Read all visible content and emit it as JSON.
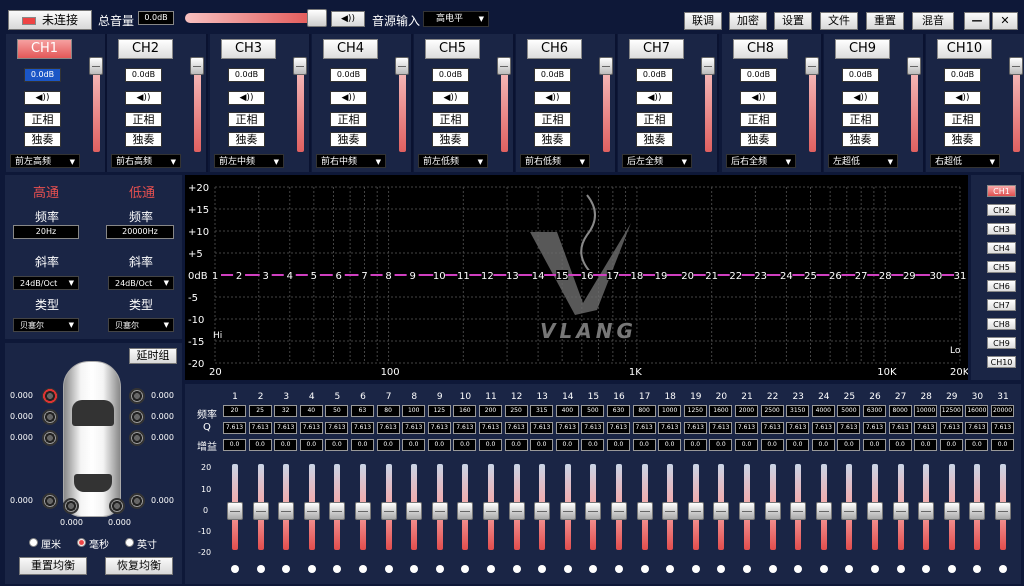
{
  "toolbar": {
    "connect_label": "未连接",
    "master_label": "总音量",
    "master_value": "0.0dB",
    "source_label": "音源输入",
    "source_value": "高电平",
    "buttons": [
      "联调",
      "加密",
      "设置",
      "文件",
      "重置",
      "混音"
    ],
    "minimize": "—",
    "close": "✕"
  },
  "channels": [
    {
      "name": "CH1",
      "vol": "0.0dB",
      "mute": "◀))",
      "phase": "正相",
      "solo": "独奏",
      "assign": "前左高频"
    },
    {
      "name": "CH2",
      "vol": "0.0dB",
      "mute": "◀))",
      "phase": "正相",
      "solo": "独奏",
      "assign": "前右高频"
    },
    {
      "name": "CH3",
      "vol": "0.0dB",
      "mute": "◀))",
      "phase": "正相",
      "solo": "独奏",
      "assign": "前左中频"
    },
    {
      "name": "CH4",
      "vol": "0.0dB",
      "mute": "◀))",
      "phase": "正相",
      "solo": "独奏",
      "assign": "前右中频"
    },
    {
      "name": "CH5",
      "vol": "0.0dB",
      "mute": "◀))",
      "phase": "正相",
      "solo": "独奏",
      "assign": "前左低频"
    },
    {
      "name": "CH6",
      "vol": "0.0dB",
      "mute": "◀))",
      "phase": "正相",
      "solo": "独奏",
      "assign": "前右低频"
    },
    {
      "name": "CH7",
      "vol": "0.0dB",
      "mute": "◀))",
      "phase": "正相",
      "solo": "独奏",
      "assign": "后左全频"
    },
    {
      "name": "CH8",
      "vol": "0.0dB",
      "mute": "◀))",
      "phase": "正相",
      "solo": "独奏",
      "assign": "后右全频"
    },
    {
      "name": "CH9",
      "vol": "0.0dB",
      "mute": "◀))",
      "phase": "正相",
      "solo": "独奏",
      "assign": "左超低"
    },
    {
      "name": "CH10",
      "vol": "0.0dB",
      "mute": "◀))",
      "phase": "正相",
      "solo": "独奏",
      "assign": "右超低"
    }
  ],
  "crossover": {
    "hp_title": "高通",
    "lp_title": "低通",
    "freq_label": "频率",
    "hp_freq": "20Hz",
    "lp_freq": "20000Hz",
    "slope_label": "斜率",
    "hp_slope": "24dB/Oct",
    "lp_slope": "24dB/Oct",
    "type_label": "类型",
    "hp_type": "贝塞尔",
    "lp_type": "贝塞尔"
  },
  "graph": {
    "y_ticks": [
      "+20",
      "+15",
      "+10",
      "+5",
      "0dB",
      "-5",
      "-10",
      "-15",
      "-20"
    ],
    "x_ticks": [
      "20",
      "100",
      "1K",
      "10K",
      "20K"
    ],
    "band_markers": [
      "1",
      "2",
      "3",
      "4",
      "5",
      "6",
      "7",
      "8",
      "9",
      "10",
      "11",
      "12",
      "13",
      "14",
      "15",
      "16",
      "17",
      "18",
      "19",
      "20",
      "21",
      "22",
      "23",
      "24",
      "25",
      "26",
      "27",
      "28",
      "29",
      "30",
      "31"
    ],
    "hi_label": "Hi",
    "lo_label": "Lo",
    "logo_text": "VLANG",
    "curve_color": "#d040c0"
  },
  "channel_list": [
    "CH1",
    "CH2",
    "CH3",
    "CH4",
    "CH5",
    "CH6",
    "CH7",
    "CH8",
    "CH9",
    "CH10"
  ],
  "eq": {
    "freq_label": "频率",
    "q_label": "Q",
    "gain_label": "增益",
    "scale": [
      "20",
      "10",
      "0",
      "-10",
      "-20"
    ],
    "bands": [
      {
        "n": "1",
        "f": "20",
        "q": "7.613",
        "g": "0.0"
      },
      {
        "n": "2",
        "f": "25",
        "q": "7.613",
        "g": "0.0"
      },
      {
        "n": "3",
        "f": "32",
        "q": "7.613",
        "g": "0.0"
      },
      {
        "n": "4",
        "f": "40",
        "q": "7.613",
        "g": "0.0"
      },
      {
        "n": "5",
        "f": "50",
        "q": "7.613",
        "g": "0.0"
      },
      {
        "n": "6",
        "f": "63",
        "q": "7.613",
        "g": "0.0"
      },
      {
        "n": "7",
        "f": "80",
        "q": "7.613",
        "g": "0.0"
      },
      {
        "n": "8",
        "f": "100",
        "q": "7.613",
        "g": "0.0"
      },
      {
        "n": "9",
        "f": "125",
        "q": "7.613",
        "g": "0.0"
      },
      {
        "n": "10",
        "f": "160",
        "q": "7.613",
        "g": "0.0"
      },
      {
        "n": "11",
        "f": "200",
        "q": "7.613",
        "g": "0.0"
      },
      {
        "n": "12",
        "f": "250",
        "q": "7.613",
        "g": "0.0"
      },
      {
        "n": "13",
        "f": "315",
        "q": "7.613",
        "g": "0.0"
      },
      {
        "n": "14",
        "f": "400",
        "q": "7.613",
        "g": "0.0"
      },
      {
        "n": "15",
        "f": "500",
        "q": "7.613",
        "g": "0.0"
      },
      {
        "n": "16",
        "f": "630",
        "q": "7.613",
        "g": "0.0"
      },
      {
        "n": "17",
        "f": "800",
        "q": "7.613",
        "g": "0.0"
      },
      {
        "n": "18",
        "f": "1000",
        "q": "7.613",
        "g": "0.0"
      },
      {
        "n": "19",
        "f": "1250",
        "q": "7.613",
        "g": "0.0"
      },
      {
        "n": "20",
        "f": "1600",
        "q": "7.613",
        "g": "0.0"
      },
      {
        "n": "21",
        "f": "2000",
        "q": "7.613",
        "g": "0.0"
      },
      {
        "n": "22",
        "f": "2500",
        "q": "7.613",
        "g": "0.0"
      },
      {
        "n": "23",
        "f": "3150",
        "q": "7.613",
        "g": "0.0"
      },
      {
        "n": "24",
        "f": "4000",
        "q": "7.613",
        "g": "0.0"
      },
      {
        "n": "25",
        "f": "5000",
        "q": "7.613",
        "g": "0.0"
      },
      {
        "n": "26",
        "f": "6300",
        "q": "7.613",
        "g": "0.0"
      },
      {
        "n": "27",
        "f": "8000",
        "q": "7.613",
        "g": "0.0"
      },
      {
        "n": "28",
        "f": "10000",
        "q": "7.613",
        "g": "0.0"
      },
      {
        "n": "29",
        "f": "12500",
        "q": "7.613",
        "g": "0.0"
      },
      {
        "n": "30",
        "f": "16000",
        "q": "7.613",
        "g": "0.0"
      },
      {
        "n": "31",
        "f": "20000",
        "q": "7.613",
        "g": "0.0"
      }
    ]
  },
  "delay": {
    "group_button": "延时组",
    "values": [
      "0.000",
      "0.000",
      "0.000",
      "0.000",
      "0.000",
      "0.000",
      "0.000",
      "0.000",
      "0.000",
      "0.000"
    ],
    "unit_cm": "厘米",
    "unit_ms": "毫秒",
    "unit_in": "英寸",
    "reset_button": "重置均衡",
    "restore_button": "恢复均衡"
  }
}
